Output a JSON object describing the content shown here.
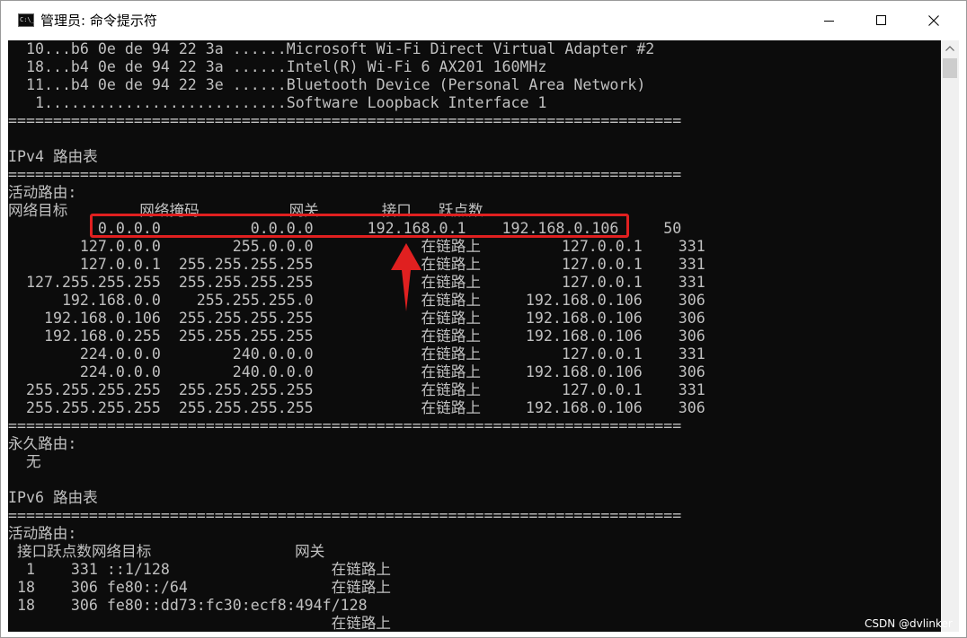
{
  "window": {
    "title": "管理员: 命令提示符",
    "icon_label": "C:\\_"
  },
  "console": {
    "lines": [
      "  10...b6 0e de 94 22 3a ......Microsoft Wi-Fi Direct Virtual Adapter #2",
      "  18...b4 0e de 94 22 3a ......Intel(R) Wi-Fi 6 AX201 160MHz",
      "  11...b4 0e de 94 22 3e ......Bluetooth Device (Personal Area Network)",
      "   1...........................Software Loopback Interface 1",
      "===========================================================================",
      "",
      "IPv4 路由表",
      "===========================================================================",
      "活动路由:",
      "网络目标        网络掩码          网关       接口   跃点数",
      "          0.0.0.0          0.0.0.0      192.168.0.1    192.168.0.106     50",
      "        127.0.0.0        255.0.0.0            在链路上         127.0.0.1    331",
      "        127.0.0.1  255.255.255.255            在链路上         127.0.0.1    331",
      "  127.255.255.255  255.255.255.255            在链路上         127.0.0.1    331",
      "      192.168.0.0    255.255.255.0            在链路上     192.168.0.106    306",
      "    192.168.0.106  255.255.255.255            在链路上     192.168.0.106    306",
      "    192.168.0.255  255.255.255.255            在链路上     192.168.0.106    306",
      "        224.0.0.0        240.0.0.0            在链路上         127.0.0.1    331",
      "        224.0.0.0        240.0.0.0            在链路上     192.168.0.106    306",
      "  255.255.255.255  255.255.255.255            在链路上         127.0.0.1    331",
      "  255.255.255.255  255.255.255.255            在链路上     192.168.0.106    306",
      "===========================================================================",
      "永久路由:",
      "  无",
      "",
      "IPv6 路由表",
      "===========================================================================",
      "活动路由:",
      " 接口跃点数网络目标                网关",
      "  1    331 ::1/128                  在链路上",
      " 18    306 fe80::/64                在链路上",
      " 18    306 fe80::dd73:fc30:ecf8:494f/128",
      "                                    在链路上"
    ]
  },
  "watermark": "CSDN @dvlinker",
  "colors": {
    "console_bg": "#0c0c0c",
    "console_text": "#c0c0c0",
    "highlight": "#e02020"
  }
}
